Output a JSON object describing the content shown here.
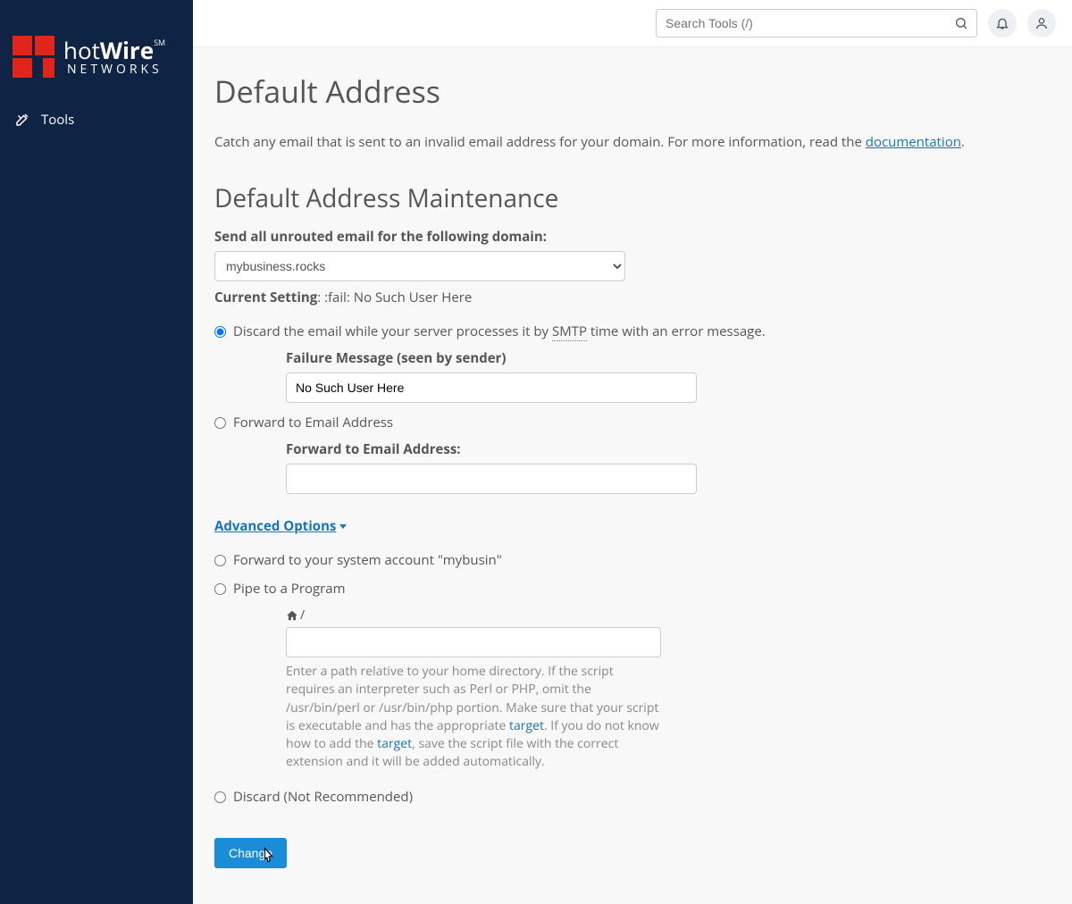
{
  "brand": {
    "word1": "hot",
    "word2": "Wire",
    "sm": "SM",
    "sub": "NETWORKS"
  },
  "sidebar": {
    "items": [
      {
        "label": "Tools"
      }
    ]
  },
  "search": {
    "placeholder": "Search Tools (/)"
  },
  "page": {
    "title": "Default Address",
    "desc_prefix": "Catch any email that is sent to an invalid email address for your domain. For more information, read the ",
    "doc_link": "documentation",
    "desc_suffix": "."
  },
  "maintenance": {
    "heading": "Default Address Maintenance",
    "domain_label": "Send all unrouted email for the following domain:",
    "domain_value": "mybusiness.rocks",
    "current_label": "Current Setting",
    "current_value": ": :fail: No Such User Here"
  },
  "options": {
    "discard_smtp": {
      "prefix": "Discard the email while your server processes it by ",
      "smtp": "SMTP",
      "suffix": " time with an error message.",
      "failure_label": "Failure Message (seen by sender)",
      "failure_value": "No Such User Here"
    },
    "forward_email": {
      "label": "Forward to Email Address",
      "sub_label": "Forward to Email Address:"
    },
    "advanced_label": "Advanced Options ",
    "forward_sys": "Forward to your system account \"mybusin\"",
    "pipe": {
      "label": "Pipe to a Program",
      "prefix_slash": "/",
      "help_1": "Enter a path relative to your home directory. If the script requires an interpreter such as Perl or PHP, omit the /usr/bin/perl or /usr/bin/php portion. Make sure that your script is executable and has the appropriate ",
      "target1": "target",
      "help_2": ". If you do not know how to add the ",
      "target2": "target",
      "help_3": ", save the script file with the correct extension and it will be added automatically."
    },
    "discard_plain": "Discard (Not Recommended)"
  },
  "buttons": {
    "change": "Change"
  }
}
